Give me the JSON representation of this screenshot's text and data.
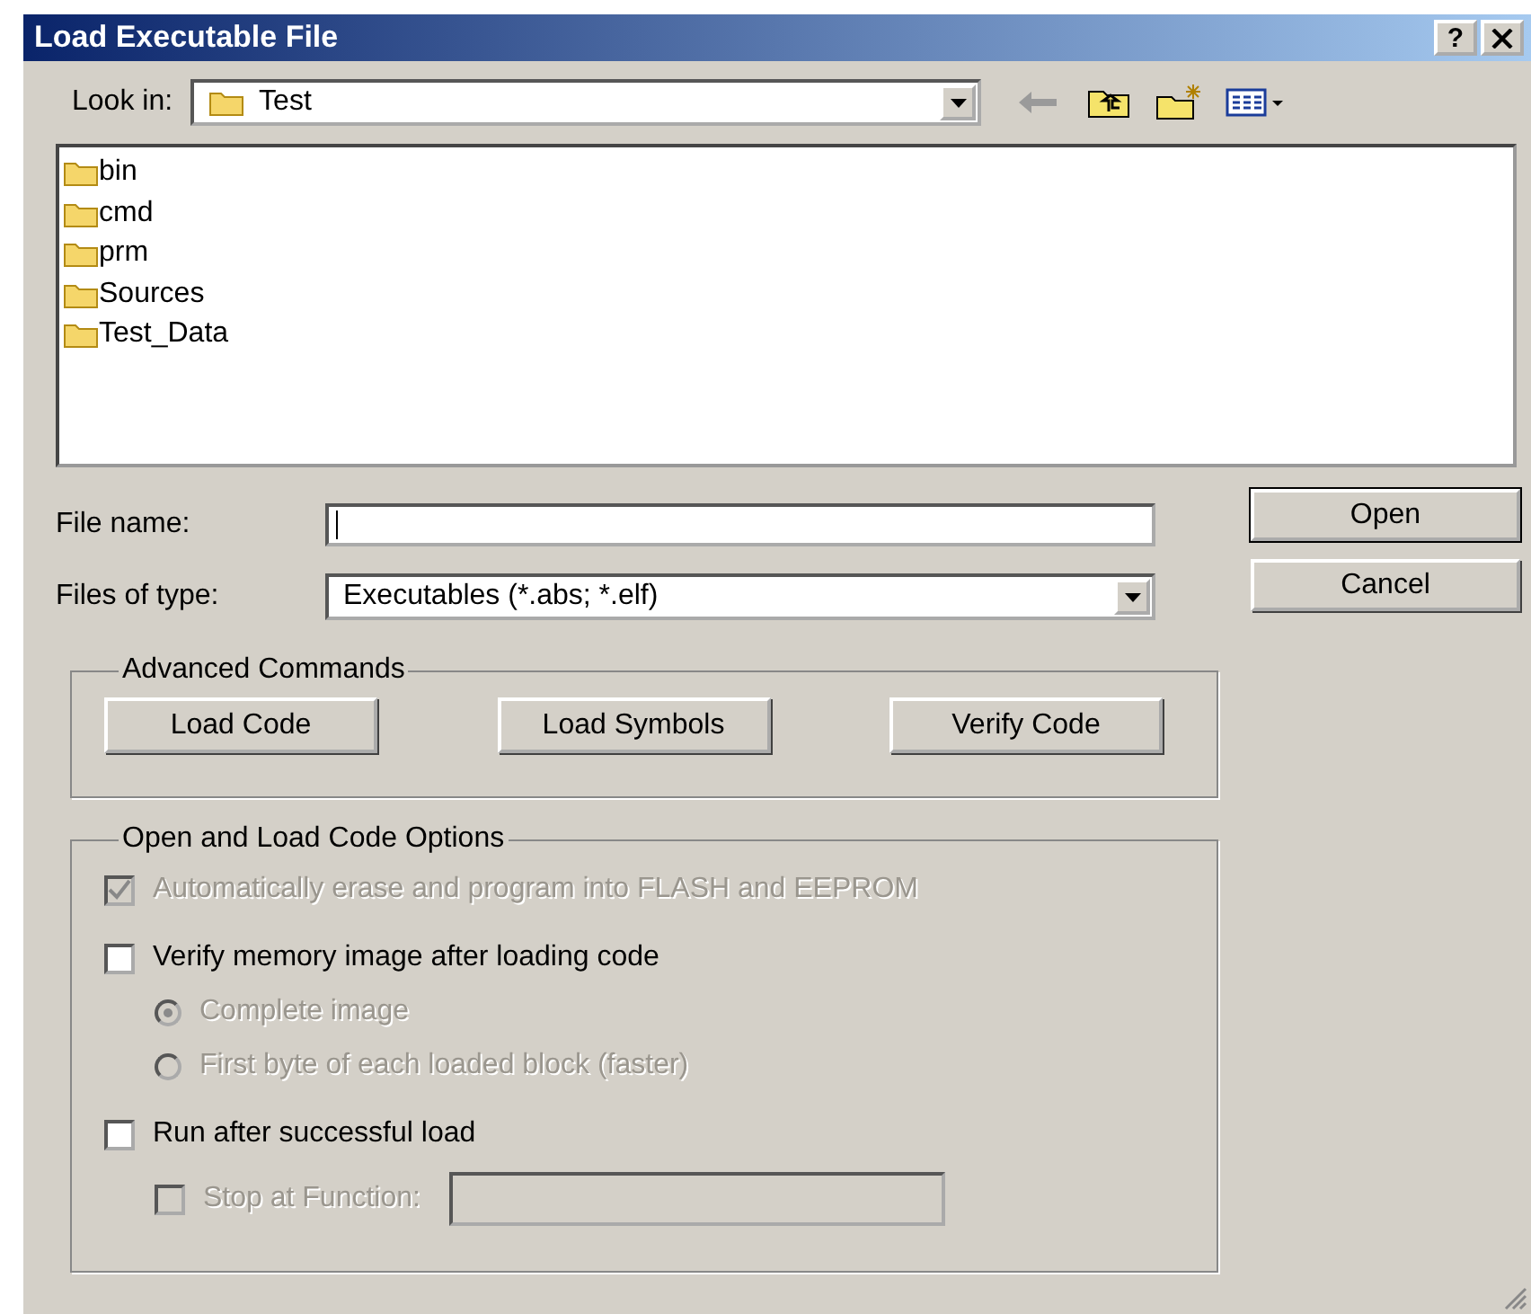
{
  "window": {
    "title": "Load Executable File",
    "help": "?"
  },
  "look_in": {
    "label": "Look in:",
    "value": "Test"
  },
  "files": [
    {
      "name": "bin"
    },
    {
      "name": "cmd"
    },
    {
      "name": "prm"
    },
    {
      "name": "Sources"
    },
    {
      "name": "Test_Data"
    }
  ],
  "file_name": {
    "label": "File name:"
  },
  "files_of_type": {
    "label": "Files of type:",
    "value": "Executables (*.abs; *.elf)"
  },
  "buttons": [
    {
      "label": "Open",
      "default": true
    },
    {
      "label": "Cancel",
      "default": false
    }
  ],
  "advanced": {
    "title": "Advanced Commands",
    "buttons": [
      "Load Code",
      "Load Symbols",
      "Verify Code"
    ]
  },
  "options": {
    "title": "Open and Load Code Options",
    "items": [
      {
        "kind": "checkbox",
        "label": "Automatically erase and program into FLASH and EEPROM",
        "checked": true,
        "disabled": true
      },
      {
        "kind": "checkbox",
        "label": "Verify memory image after loading code",
        "checked": false,
        "disabled": false,
        "children": [
          {
            "kind": "radio",
            "label": "Complete image",
            "selected": true,
            "disabled": true
          },
          {
            "kind": "radio",
            "label": "First byte of each loaded block (faster)",
            "selected": false,
            "disabled": true
          }
        ]
      },
      {
        "kind": "checkbox",
        "label": "Run after successful load",
        "checked": false,
        "disabled": false,
        "children": [
          {
            "kind": "field",
            "label": "Stop at Function:",
            "checked": false,
            "disabled": true
          }
        ]
      }
    ]
  }
}
